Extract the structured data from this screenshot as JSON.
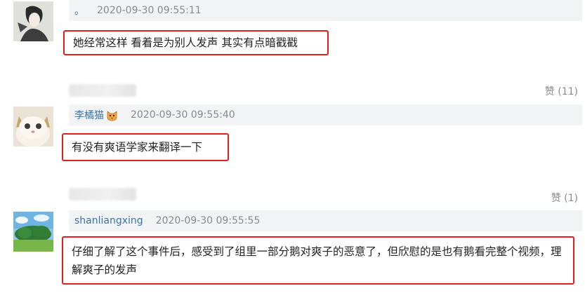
{
  "comments": [
    {
      "user": "。",
      "time": "2020-09-30 09:55:11",
      "text": "她经常这样 看着是为别人发声 其实有点暗戳戳"
    },
    {
      "user": "李橘猫",
      "time": "2020-09-30 09:55:40",
      "text": "有没有爽语学家来翻译一下"
    },
    {
      "user": "shanliangxing",
      "time": "2020-09-30 09:55:55",
      "text": "仔细了解了这个事件后，感受到了组里一部分鹅对爽子的恶意了，但欣慰的是也有鹅看完整个视频，理解爽子的发声"
    }
  ],
  "likes": [
    {
      "label": "赞 (11)"
    },
    {
      "label": "赞 (1)"
    }
  ],
  "colors": {
    "highlight_border": "#e11d1d",
    "username": "#3c74a8",
    "meta_bg": "#f1f3f5"
  },
  "icons": {
    "user2_badge": "cat-face-emoji-icon"
  }
}
